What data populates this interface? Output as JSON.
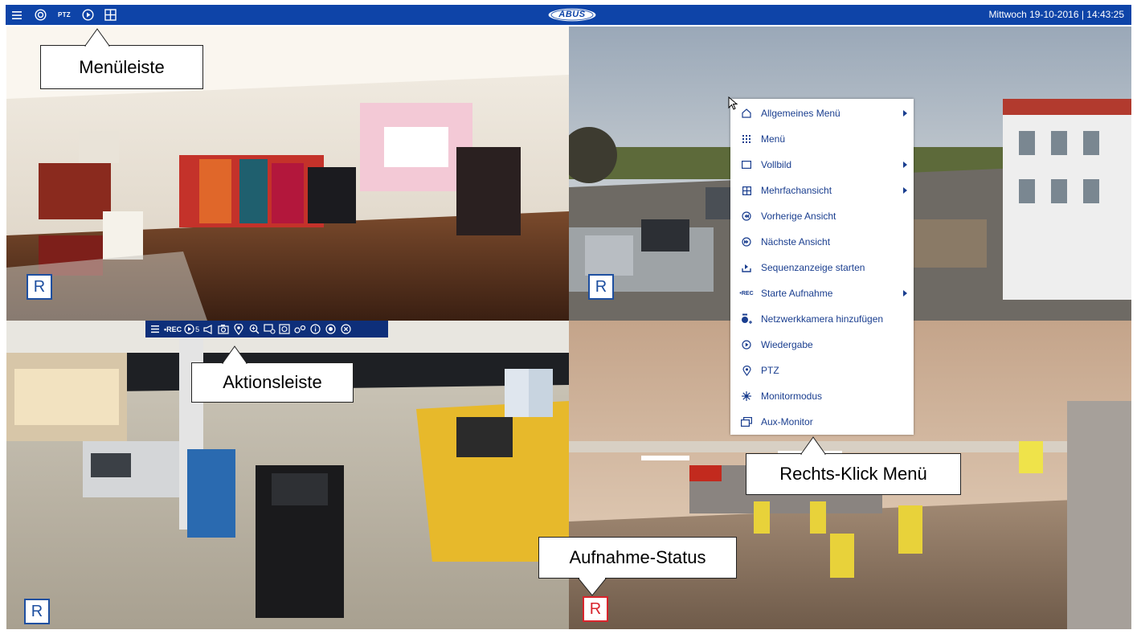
{
  "topbar": {
    "icons": [
      "menu-icon",
      "camera-view-icon",
      "ptz-icon",
      "playback-icon",
      "layout-icon"
    ],
    "ptz_label": "PTZ",
    "logo_text": "ABUS",
    "datetime": "Mittwoch 19-10-2016 |  14:43:25",
    "color": "#0e44a8"
  },
  "cameras": [
    {
      "scene": "Boutique-Innenansicht",
      "badge": "R",
      "recording": false,
      "selected": true
    },
    {
      "scene": "Parkplatz Außenansicht",
      "badge": "R",
      "recording": false,
      "selected": false
    },
    {
      "scene": "Tankstelle",
      "badge": "R",
      "recording": false,
      "selected": false
    },
    {
      "scene": "Parkhaus",
      "badge": "R",
      "recording": true,
      "selected": false
    }
  ],
  "callouts": {
    "menubar": "Menüleiste",
    "actionbar": "Aktionsleiste",
    "rightclick": "Rechts-Klick Menü",
    "recstatus": "Aufnahme-Status"
  },
  "actionbar": {
    "rec_label": "•REC",
    "playback_sub": "5",
    "icons": [
      "menu-icon",
      "rec-icon",
      "instant-playback-icon",
      "audio-icon",
      "snapshot-icon",
      "ptz-icon",
      "zoom-icon",
      "image-settings-icon",
      "face-icon",
      "settings-icon",
      "info-icon",
      "stream-icon",
      "close-icon"
    ]
  },
  "context_menu": {
    "items": [
      {
        "label": "Allgemeines Menü",
        "icon": "home-icon",
        "submenu": true
      },
      {
        "label": "Menü",
        "icon": "grid-icon",
        "submenu": false
      },
      {
        "label": "Vollbild",
        "icon": "fullscreen-icon",
        "submenu": true
      },
      {
        "label": "Mehrfachansicht",
        "icon": "multiview-icon",
        "submenu": true
      },
      {
        "label": "Vorherige Ansicht",
        "icon": "previous-icon",
        "submenu": false
      },
      {
        "label": "Nächste Ansicht",
        "icon": "next-icon",
        "submenu": false
      },
      {
        "label": "Sequenzanzeige starten",
        "icon": "sequence-icon",
        "submenu": false
      },
      {
        "label": "Starte Aufnahme",
        "icon": "rec-icon",
        "icon_text": "•REC",
        "submenu": true
      },
      {
        "label": "Netzwerkkamera hinzufügen",
        "icon": "add-camera-icon",
        "submenu": false
      },
      {
        "label": "Wiedergabe",
        "icon": "playback-icon",
        "submenu": false
      },
      {
        "label": "PTZ",
        "icon": "ptz-icon",
        "submenu": false
      },
      {
        "label": "Monitormodus",
        "icon": "monitor-mode-icon",
        "submenu": false
      },
      {
        "label": "Aux-Monitor",
        "icon": "aux-monitor-icon",
        "submenu": false
      }
    ]
  }
}
